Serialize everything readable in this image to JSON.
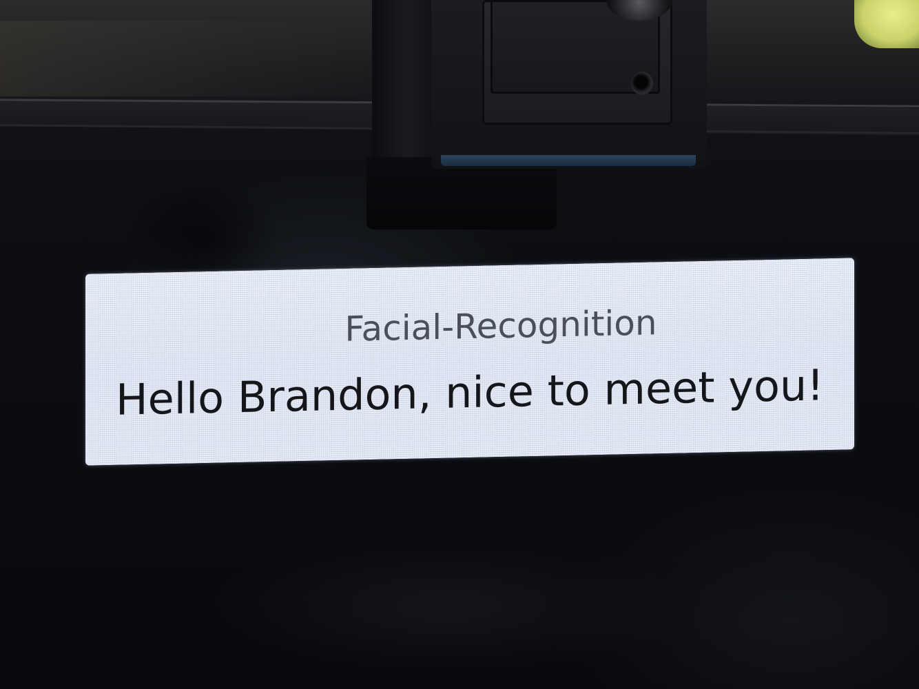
{
  "display": {
    "title": "Facial-Recognition",
    "message": "Hello Brandon, nice to meet you!"
  },
  "colors": {
    "panel_background": "#e9eef9",
    "title_text": "#4a4f58",
    "message_text": "#141619",
    "surround": "#080a10"
  }
}
